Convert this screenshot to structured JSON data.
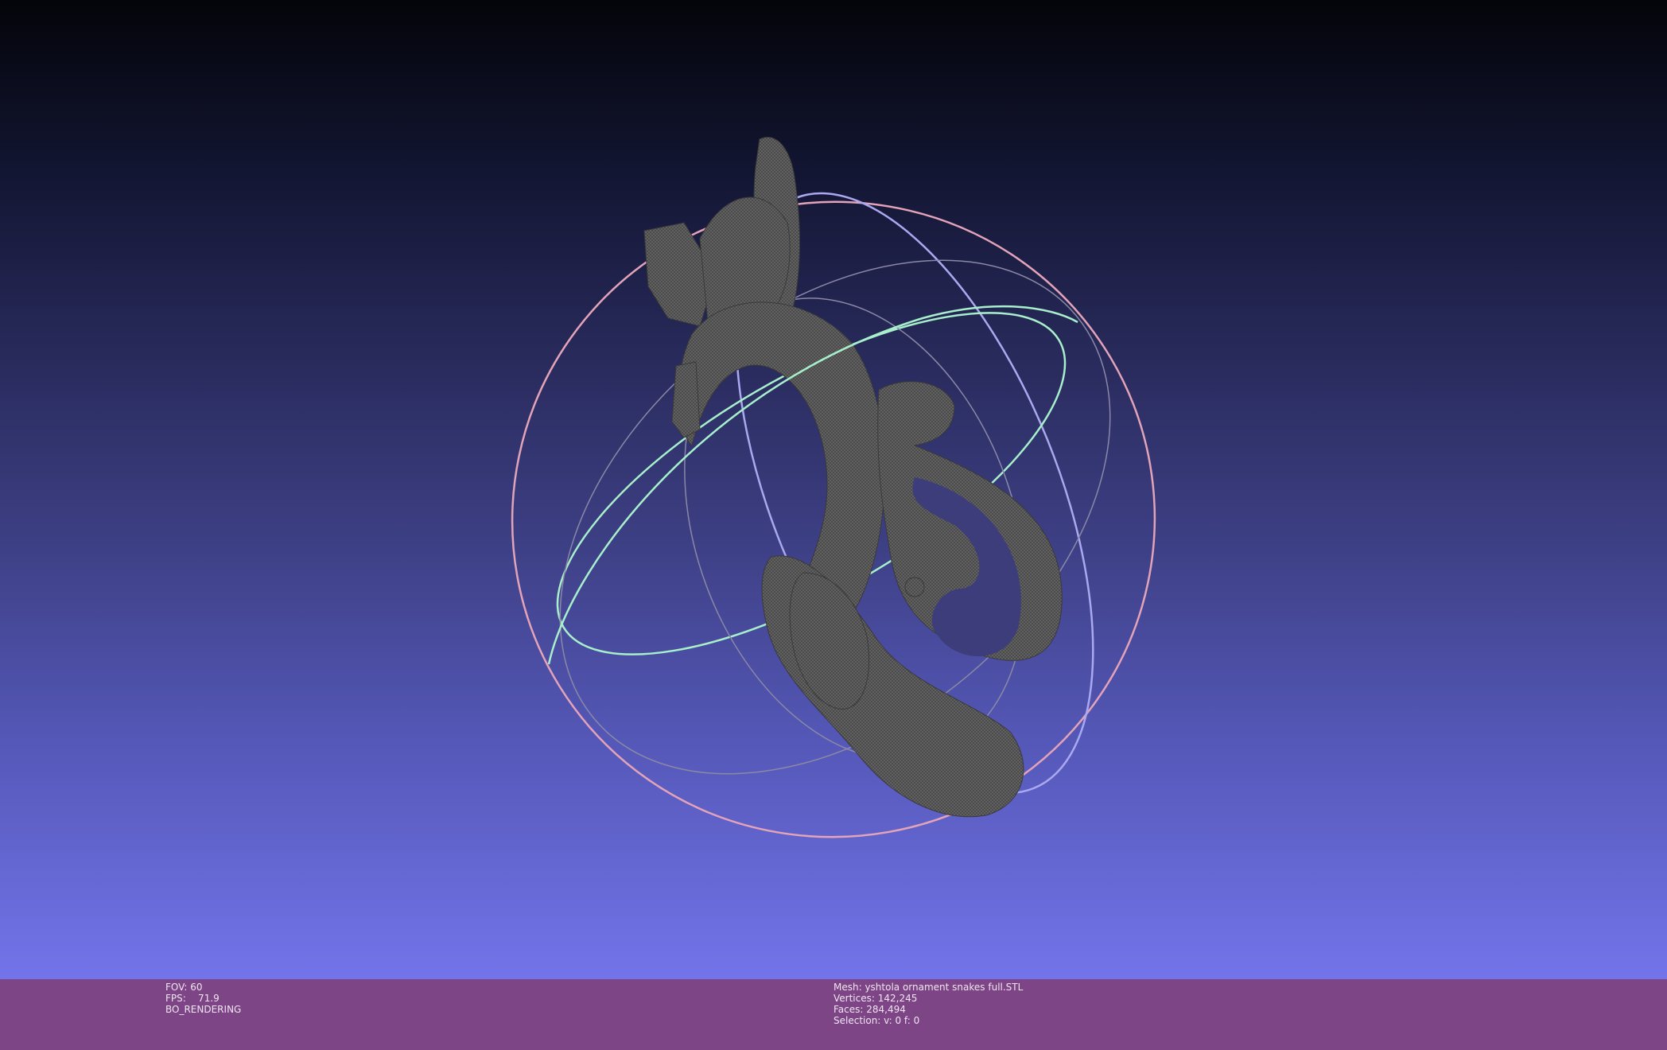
{
  "viewer": {
    "scene": "3d-mesh-viewport",
    "background_gradient": [
      "#04040a",
      "#2a2c5f",
      "#7374ea"
    ],
    "mesh_color": "#505050",
    "trackball_colors": {
      "ring_x": "#a9a9f5",
      "ring_y": "#9ff0c6",
      "ring_z": "#e0a0b5",
      "ring_guides": "#8a8aa0"
    }
  },
  "status_left": {
    "fov": "FOV: 60",
    "fps": "FPS:    71.9",
    "render_mode": "BO_RENDERING"
  },
  "status_mid": {
    "mesh": "Mesh: yshtola ornament snakes full.STL",
    "vertices": "Vertices: 142,245",
    "faces": "Faces: 284,494",
    "selection": "Selection: v: 0 f: 0"
  },
  "infobar_color": "#7d4586"
}
